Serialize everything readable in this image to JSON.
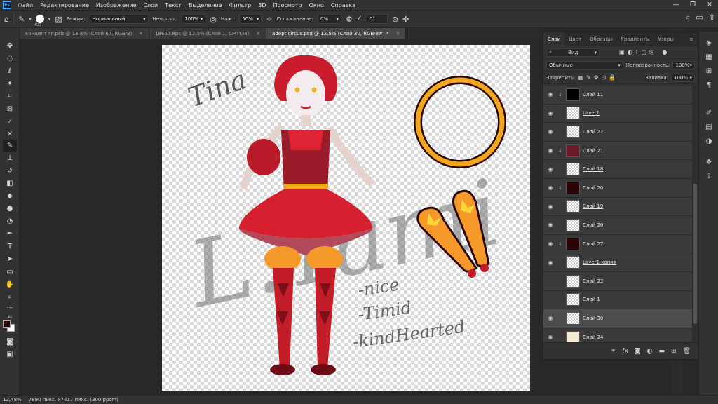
{
  "app": {
    "logo": "Ps"
  },
  "menu": [
    "Файл",
    "Редактирование",
    "Изображение",
    "Слои",
    "Текст",
    "Выделение",
    "Фильтр",
    "3D",
    "Просмотр",
    "Окно",
    "Справка"
  ],
  "window_controls": [
    "—",
    "❐",
    "✕"
  ],
  "options": {
    "brush_size": "400",
    "mode_label": "Режим:",
    "mode_value": "Нормальный",
    "opacity_label": "Непрозр.:",
    "opacity_value": "100%",
    "flow_label": "Наж.:",
    "flow_value": "50%",
    "smoothing_label": "Сглаживание:",
    "smoothing_value": "0%",
    "angle_value": "0°"
  },
  "tabs": [
    {
      "label": "концепт гг.psb @ 13,8% (Слой 67, RGB/8)",
      "active": false
    },
    {
      "label": "18657.eps @ 12,5% (Слой 1, CMYK/8)",
      "active": false
    },
    {
      "label": "adopt circus.psd @ 12,5% (Слой 30, RGB/8#) *",
      "active": true
    }
  ],
  "canvas_text": {
    "name": "Tina",
    "watermark": "L.Tami",
    "trait1": "-nice",
    "trait2": "-Timid",
    "trait3": "-kindHearted"
  },
  "panel": {
    "tabs": [
      "Слои",
      "Цвет",
      "Образцы",
      "Градиенты",
      "Узоры"
    ],
    "filter_value": "Вид",
    "blend_mode": "Обычные",
    "opacity_label": "Непрозрачность:",
    "opacity_value": "100%",
    "lock_label": "Закрепить:",
    "fill_label": "Заливка:",
    "fill_value": "100%"
  },
  "layers": [
    {
      "name": "Слой 11",
      "visible": true,
      "clip": true,
      "thumb_color": "#000000",
      "underline": false,
      "selected": false
    },
    {
      "name": "Layer1",
      "visible": true,
      "clip": false,
      "thumb_color": "",
      "underline": true,
      "selected": false
    },
    {
      "name": "Слой 22",
      "visible": true,
      "clip": false,
      "thumb_color": "",
      "underline": false,
      "selected": false
    },
    {
      "name": "Слой 21",
      "visible": true,
      "clip": true,
      "thumb_color": "#6b1a2a",
      "underline": false,
      "selected": false
    },
    {
      "name": "Слой 18",
      "visible": true,
      "clip": false,
      "thumb_color": "",
      "underline": true,
      "selected": false
    },
    {
      "name": "Слой 20",
      "visible": true,
      "clip": true,
      "thumb_color": "#2a0505",
      "underline": false,
      "selected": false
    },
    {
      "name": "Слой 19",
      "visible": true,
      "clip": false,
      "thumb_color": "",
      "underline": true,
      "selected": false
    },
    {
      "name": "Слой 26",
      "visible": true,
      "clip": false,
      "thumb_color": "",
      "underline": false,
      "selected": false
    },
    {
      "name": "Слой 27",
      "visible": true,
      "clip": true,
      "thumb_color": "#2a0505",
      "underline": false,
      "selected": false
    },
    {
      "name": "Layer1 копия",
      "visible": true,
      "clip": false,
      "thumb_color": "",
      "underline": true,
      "selected": false
    },
    {
      "name": "Слой 23",
      "visible": false,
      "clip": false,
      "thumb_color": "",
      "underline": false,
      "selected": false
    },
    {
      "name": "Слой 1",
      "visible": false,
      "clip": false,
      "thumb_color": "",
      "underline": false,
      "selected": false
    },
    {
      "name": "Слой 30",
      "visible": true,
      "clip": false,
      "thumb_color": "",
      "underline": false,
      "selected": true
    },
    {
      "name": "Слой 24",
      "visible": true,
      "clip": false,
      "thumb_color": "#f3ecd2",
      "underline": false,
      "selected": false
    }
  ],
  "status": {
    "zoom": "12,48%",
    "doc_info": "7890 пикс. x7417 пикс. (300 ppcm)"
  }
}
